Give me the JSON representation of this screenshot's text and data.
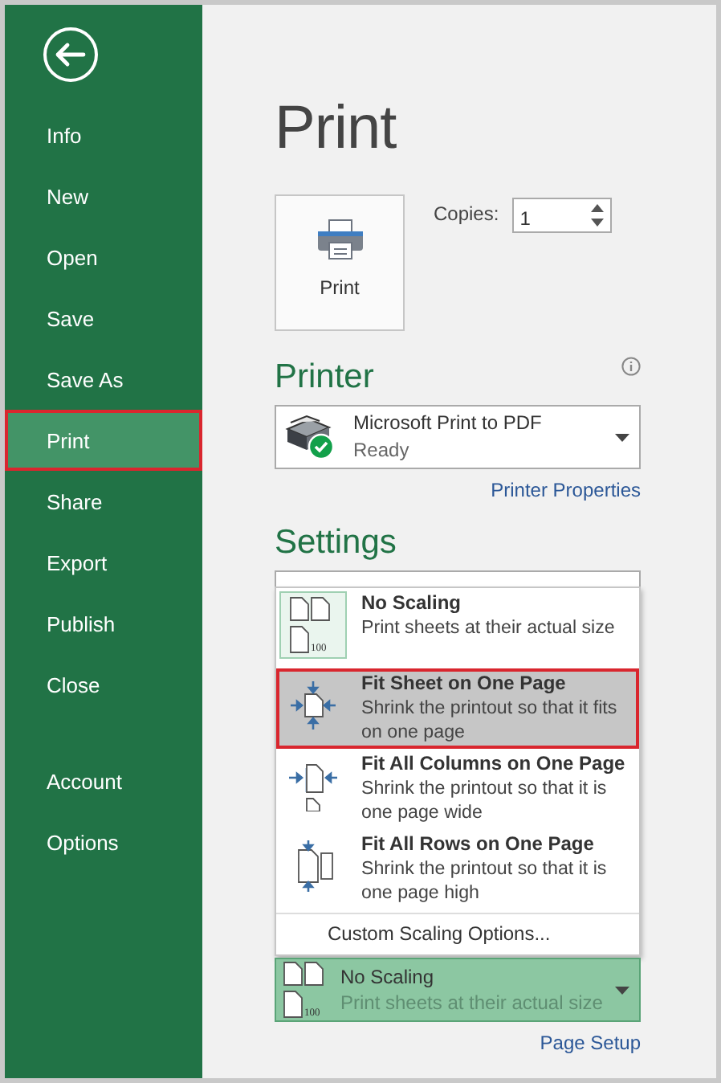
{
  "sidebar": {
    "items": [
      {
        "label": "Info",
        "selected": false
      },
      {
        "label": "New",
        "selected": false
      },
      {
        "label": "Open",
        "selected": false
      },
      {
        "label": "Save",
        "selected": false
      },
      {
        "label": "Save As",
        "selected": false
      },
      {
        "label": "Print",
        "selected": true
      },
      {
        "label": "Share",
        "selected": false
      },
      {
        "label": "Export",
        "selected": false
      },
      {
        "label": "Publish",
        "selected": false
      },
      {
        "label": "Close",
        "selected": false
      }
    ],
    "footer_items": [
      {
        "label": "Account",
        "selected": false
      },
      {
        "label": "Options",
        "selected": false
      }
    ]
  },
  "main": {
    "title": "Print",
    "print_button": {
      "label": "Print"
    },
    "copies": {
      "label": "Copies:",
      "value": "1"
    },
    "printer": {
      "heading": "Printer",
      "device": {
        "name": "Microsoft Print to PDF",
        "status": "Ready"
      },
      "properties_link": "Printer Properties"
    },
    "settings": {
      "heading": "Settings",
      "scaling_menu": {
        "options": [
          {
            "kind": "no-scaling",
            "icon_text": "100",
            "title": "No Scaling",
            "description": "Print sheets at their actual size",
            "current": true,
            "selected": false
          },
          {
            "kind": "fit-sheet",
            "title": "Fit Sheet on One Page",
            "description": "Shrink the printout so that it fits on one page",
            "current": false,
            "selected": true
          },
          {
            "kind": "fit-columns",
            "title": "Fit All Columns on One Page",
            "description": "Shrink the printout so that it is one page wide",
            "current": false,
            "selected": false
          },
          {
            "kind": "fit-rows",
            "title": "Fit All Rows on One Page",
            "description": "Shrink the printout so that it is one page high",
            "current": false,
            "selected": false
          }
        ],
        "custom_option": "Custom Scaling Options..."
      },
      "scaling_select": {
        "kind": "no-scaling",
        "icon_text": "100",
        "title": "No Scaling",
        "description": "Print sheets at their actual size"
      },
      "page_setup_link": "Page Setup"
    }
  }
}
